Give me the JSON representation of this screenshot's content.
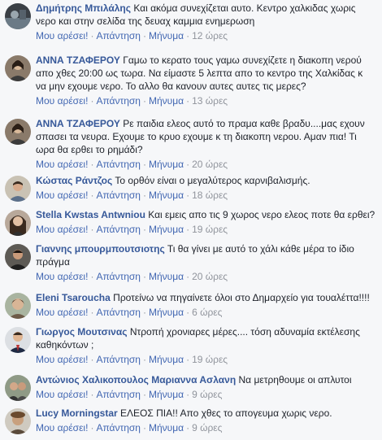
{
  "actions": {
    "like": "Μου αρέσει!",
    "reply": "Απάντηση",
    "message": "Μήνυμα",
    "separator": "·"
  },
  "colors": {
    "author": "#365899",
    "link": "#4267b2",
    "meta": "#90949c",
    "text": "#1d2129",
    "background": "#f6f7f9"
  },
  "comments": [
    {
      "author": "Δημήτρης Μπιλάλης",
      "text": "Και ακόμα συνεχίζεται αυτο. Κεντρο χαλκιδας χωρις νερο και στην σελίδα της δευαχ καμμια ενημερωση",
      "time": "12 ώρες",
      "avatar_icon": "avatar-dark-photo-icon"
    },
    {
      "author": "ΑΝΝΑ ΤΖΑΦΕΡΟΥ",
      "text": "Γαμω το κερατο τους γαμω συνεχίζετε η διακοπη νερού απο χθες 20:00 ως τωρα. Να είμαστε 5 λεπτα απο το κεντρο της Χαλκίδας κ να μην εχουμε νερο. Το αλλο θα κανουν αυτες αυτες τις μερες?",
      "time": "13 ώρες",
      "avatar_icon": "avatar-person-icon"
    },
    {
      "author": "ΑΝΝΑ ΤΖΑΦΕΡΟΥ",
      "text": "Ρε παιδια ελεος αυτό το πραμα καθε βραδυ....μας εχουν σπασει τα νευρα. Εχουμε το κρυο εχουμε κ τη διακοπη νερου. Αμαν πια! Τι ωρα θα ερθει το ρημάδι?",
      "time": "20 ώρες",
      "avatar_icon": "avatar-person-icon"
    },
    {
      "author": "Κώστας Ράντζος",
      "text": "Το ορθόν είναι ο μεγαλύτερος καρνιβαλισμής.",
      "time": "18 ώρες",
      "avatar_icon": "avatar-person-icon"
    },
    {
      "author": "Stella Kwstas Antwniou",
      "text": "Και εμεις απο τις 9 χωρος νερο ελεος ποτε θα ερθει?",
      "time": "19 ώρες",
      "avatar_icon": "avatar-person-icon"
    },
    {
      "author": "Γιαννης μπουρμπουτσιοτης",
      "text": "Τι θα γίνει με αυτό το χάλι κάθε μέρα το ίδιο πράγμα",
      "time": "20 ώρες",
      "avatar_icon": "avatar-person-icon"
    },
    {
      "author": "Eleni Tsaroucha",
      "text": "Προτείνω να πηγαίνετε όλοι στο Δημαρχείο για τουαλέττα!!!!",
      "time": "6 ώρες",
      "avatar_icon": "avatar-person-icon"
    },
    {
      "author": "Γιωργος Μουτσινας",
      "text": "Ντροπή χρονιαρες μέρες.... τόση αδυναμία εκτέλεσης καθηκόντων ;",
      "time": "19 ώρες",
      "avatar_icon": "avatar-person-icon"
    },
    {
      "author": "Αντώνιος Χαλικοπουλος Μαριαννα Ασλανη",
      "text": "Να μετρηθουμε οι απλυτοι",
      "time": "9 ώρες",
      "avatar_icon": "avatar-couple-icon"
    },
    {
      "author": "Lucy Morningstar",
      "text": "ΕΛΕΟΣ ΠΙΑ!! Απο χθες το απογευμα χωρις νερο.",
      "time": "9 ώρες",
      "avatar_icon": "avatar-person-icon"
    }
  ]
}
